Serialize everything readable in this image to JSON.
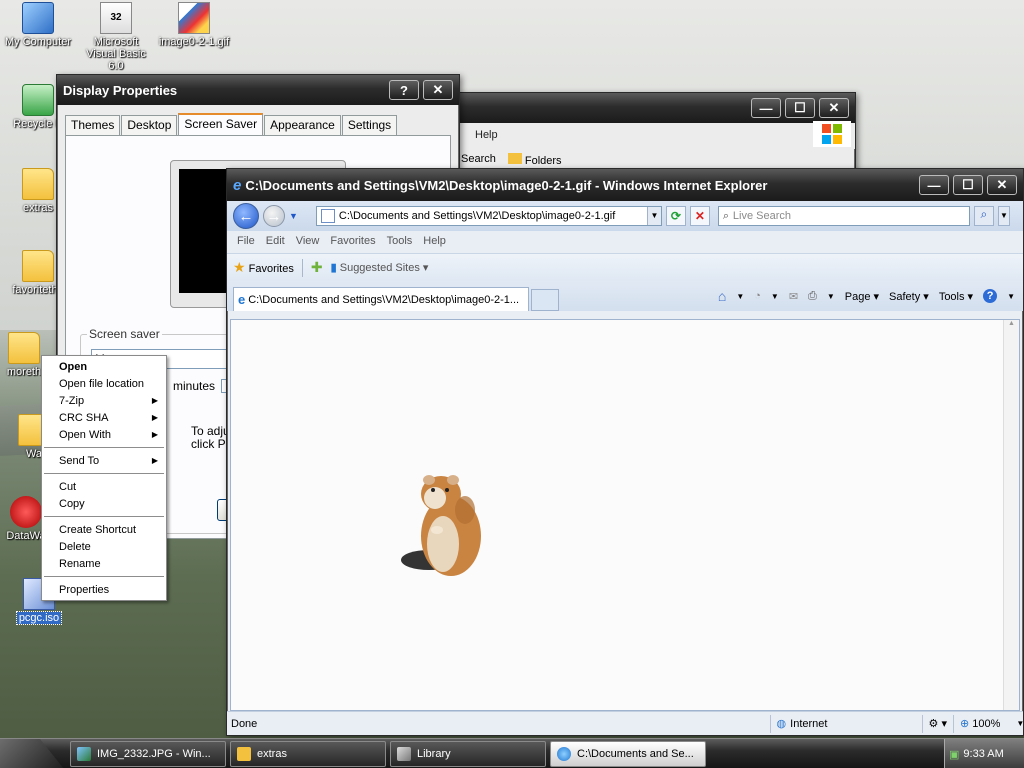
{
  "desktop": {
    "icons": [
      {
        "label": "My Computer"
      },
      {
        "label": "Microsoft Visual Basic 6.0"
      },
      {
        "label": "image0-2-1.gif"
      },
      {
        "label": "Recycle B"
      },
      {
        "label": "extras"
      },
      {
        "label": "favoritethe"
      },
      {
        "label": "moreth"
      },
      {
        "label": "Wa"
      },
      {
        "label": "DataWa"
      },
      {
        "label": "pcgc.iso"
      }
    ],
    "vb_badge": "32"
  },
  "display_properties": {
    "title": "Display Properties",
    "help": "?",
    "close": "✕",
    "tabs": [
      "Themes",
      "Desktop",
      "Screen Saver",
      "Appearance",
      "Settings"
    ],
    "active_tab": "Screen Saver",
    "group_label": "Screen saver",
    "screensaver_value": "Marquee",
    "minutes_label": "minutes",
    "power_text_1": "To adjust",
    "power_text_2": "click Pow"
  },
  "library_window": {
    "menu_help": "Help",
    "tool_search": "Search",
    "tool_folders": "Folders",
    "min": "—",
    "max": "☐",
    "close": "✕"
  },
  "ie": {
    "title": "C:\\Documents and Settings\\VM2\\Desktop\\image0-2-1.gif - Windows Internet Explorer",
    "address": "C:\\Documents and Settings\\VM2\\Desktop\\image0-2-1.gif",
    "search_placeholder": "Live Search",
    "menu": [
      "File",
      "Edit",
      "View",
      "Favorites",
      "Tools",
      "Help"
    ],
    "favorites_label": "Favorites",
    "suggested_sites": "Suggested Sites ▾",
    "tab_title": "C:\\Documents and Settings\\VM2\\Desktop\\image0-2-1...",
    "page_menu": "Page ▾",
    "safety_menu": "Safety ▾",
    "tools_menu": "Tools ▾",
    "status_done": "Done",
    "status_zone": "Internet",
    "zoom": "100%",
    "min": "—",
    "max": "☐",
    "close": "✕"
  },
  "context_menu": {
    "items": [
      {
        "label": "Open",
        "bold": true
      },
      {
        "label": "Open file location"
      },
      {
        "label": "7-Zip",
        "submenu": true
      },
      {
        "label": "CRC SHA",
        "submenu": true
      },
      {
        "label": "Open With",
        "submenu": true
      },
      {
        "label": "Send To",
        "submenu": true
      },
      {
        "label": "Cut"
      },
      {
        "label": "Copy"
      },
      {
        "label": "Create Shortcut"
      },
      {
        "label": "Delete"
      },
      {
        "label": "Rename"
      },
      {
        "label": "Properties"
      }
    ]
  },
  "taskbar": {
    "tasks": [
      {
        "label": "IMG_2332.JPG - Win..."
      },
      {
        "label": "extras"
      },
      {
        "label": "Library"
      },
      {
        "label": "C:\\Documents and Se..."
      }
    ],
    "clock": "9:33 AM"
  },
  "colors": {
    "selection": "#316ac5",
    "ie_link": "#1f56c8",
    "titlebar_dark": "#1b1b1b"
  }
}
